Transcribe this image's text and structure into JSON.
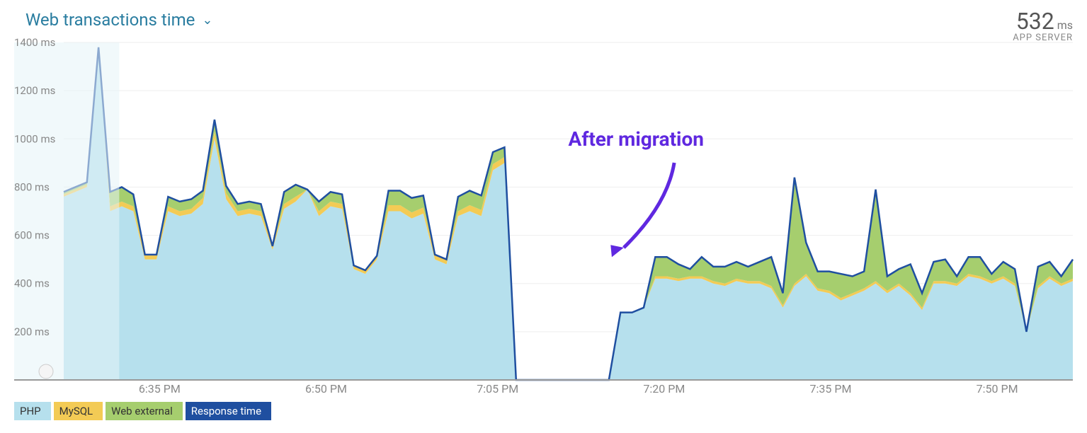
{
  "title": "Web transactions time",
  "metric": {
    "value": "532",
    "unit": "ms",
    "label": "APP SERVER"
  },
  "annotation": {
    "text": "After migration"
  },
  "legend": {
    "php": "PHP",
    "mysql": "MySQL",
    "webext": "Web external",
    "response": "Response time"
  },
  "chart_data": {
    "type": "area",
    "ylabel": "ms",
    "ylim": [
      0,
      1400
    ],
    "yticks": [
      200,
      400,
      600,
      800,
      1000,
      1200,
      1400
    ],
    "ytick_labels": [
      "200 ms",
      "400 ms",
      "600 ms",
      "800 ms",
      "1000 ms",
      "1200 ms",
      "1400 ms"
    ],
    "xticks": [
      "6:35 PM",
      "6:50 PM",
      "7:05 PM",
      "7:20 PM",
      "7:35 PM",
      "7:50 PM"
    ],
    "faded_region_end_fraction": 0.055,
    "annotation_arrow_target_fraction": 0.58,
    "x": [
      0,
      1,
      2,
      3,
      4,
      5,
      6,
      7,
      8,
      9,
      10,
      11,
      12,
      13,
      14,
      15,
      16,
      17,
      18,
      19,
      20,
      21,
      22,
      23,
      24,
      25,
      26,
      27,
      28,
      29,
      30,
      31,
      32,
      33,
      34,
      35,
      36,
      37,
      38,
      39,
      40,
      41,
      42,
      43,
      44,
      45,
      46,
      47,
      48,
      49,
      50,
      51,
      52,
      53,
      54,
      55,
      56,
      57,
      58,
      59,
      60,
      61,
      62,
      63,
      64,
      65,
      66,
      67,
      68,
      69,
      70,
      71,
      72,
      73,
      74,
      75,
      76,
      77,
      78,
      79,
      80,
      81,
      82,
      83,
      84,
      85,
      86,
      87
    ],
    "series": [
      {
        "name": "PHP",
        "color": "#b6e0ed",
        "values": [
          760,
          780,
          800,
          1380,
          700,
          720,
          700,
          500,
          500,
          700,
          680,
          690,
          730,
          1000,
          750,
          680,
          690,
          680,
          540,
          710,
          740,
          790,
          680,
          720,
          710,
          460,
          440,
          500,
          700,
          700,
          670,
          690,
          500,
          480,
          680,
          700,
          680,
          870,
          900,
          0,
          0,
          0,
          0,
          0,
          0,
          0,
          0,
          0,
          280,
          280,
          300,
          420,
          420,
          410,
          420,
          420,
          400,
          390,
          410,
          400,
          400,
          380,
          300,
          390,
          430,
          370,
          360,
          330,
          350,
          370,
          400,
          360,
          390,
          350,
          290,
          400,
          400,
          390,
          430,
          420,
          400,
          420,
          390,
          200,
          380,
          420,
          390,
          410
        ]
      },
      {
        "name": "MySQL",
        "color": "#f3cb55",
        "values": [
          10,
          10,
          10,
          0,
          20,
          20,
          20,
          20,
          20,
          20,
          20,
          20,
          25,
          30,
          25,
          20,
          20,
          20,
          15,
          20,
          20,
          0,
          20,
          20,
          20,
          15,
          15,
          15,
          25,
          25,
          25,
          25,
          20,
          20,
          20,
          25,
          25,
          25,
          25,
          0,
          0,
          0,
          0,
          0,
          0,
          0,
          0,
          0,
          0,
          0,
          0,
          10,
          10,
          10,
          10,
          10,
          10,
          10,
          10,
          10,
          10,
          10,
          10,
          10,
          10,
          10,
          10,
          10,
          10,
          10,
          10,
          10,
          10,
          10,
          10,
          10,
          10,
          10,
          10,
          10,
          10,
          10,
          10,
          0,
          10,
          10,
          10,
          10
        ]
      },
      {
        "name": "Web external",
        "color": "#a6ce6e",
        "values": [
          10,
          10,
          10,
          0,
          60,
          60,
          50,
          0,
          0,
          40,
          40,
          40,
          30,
          50,
          30,
          30,
          30,
          30,
          0,
          50,
          50,
          0,
          40,
          40,
          40,
          0,
          0,
          0,
          60,
          60,
          60,
          50,
          0,
          0,
          60,
          60,
          60,
          50,
          40,
          0,
          0,
          0,
          0,
          0,
          0,
          0,
          0,
          0,
          0,
          0,
          0,
          80,
          80,
          60,
          30,
          80,
          60,
          70,
          70,
          60,
          80,
          120,
          50,
          440,
          130,
          70,
          80,
          100,
          70,
          70,
          380,
          60,
          60,
          120,
          60,
          80,
          90,
          30,
          70,
          80,
          30,
          60,
          60,
          0,
          80,
          60,
          30,
          80
        ]
      }
    ],
    "response_time": [
      780,
      800,
      820,
      1380,
      780,
      800,
      770,
      520,
      520,
      760,
      740,
      750,
      785,
      1080,
      805,
      730,
      740,
      730,
      555,
      780,
      810,
      790,
      740,
      780,
      770,
      475,
      455,
      515,
      785,
      785,
      755,
      765,
      520,
      500,
      760,
      785,
      765,
      945,
      965,
      0,
      0,
      0,
      0,
      0,
      0,
      0,
      0,
      0,
      280,
      280,
      300,
      510,
      510,
      480,
      460,
      510,
      470,
      470,
      490,
      470,
      490,
      510,
      360,
      840,
      570,
      450,
      450,
      440,
      430,
      450,
      790,
      430,
      460,
      480,
      360,
      490,
      500,
      430,
      510,
      510,
      440,
      490,
      460,
      200,
      470,
      490,
      430,
      500
    ]
  }
}
